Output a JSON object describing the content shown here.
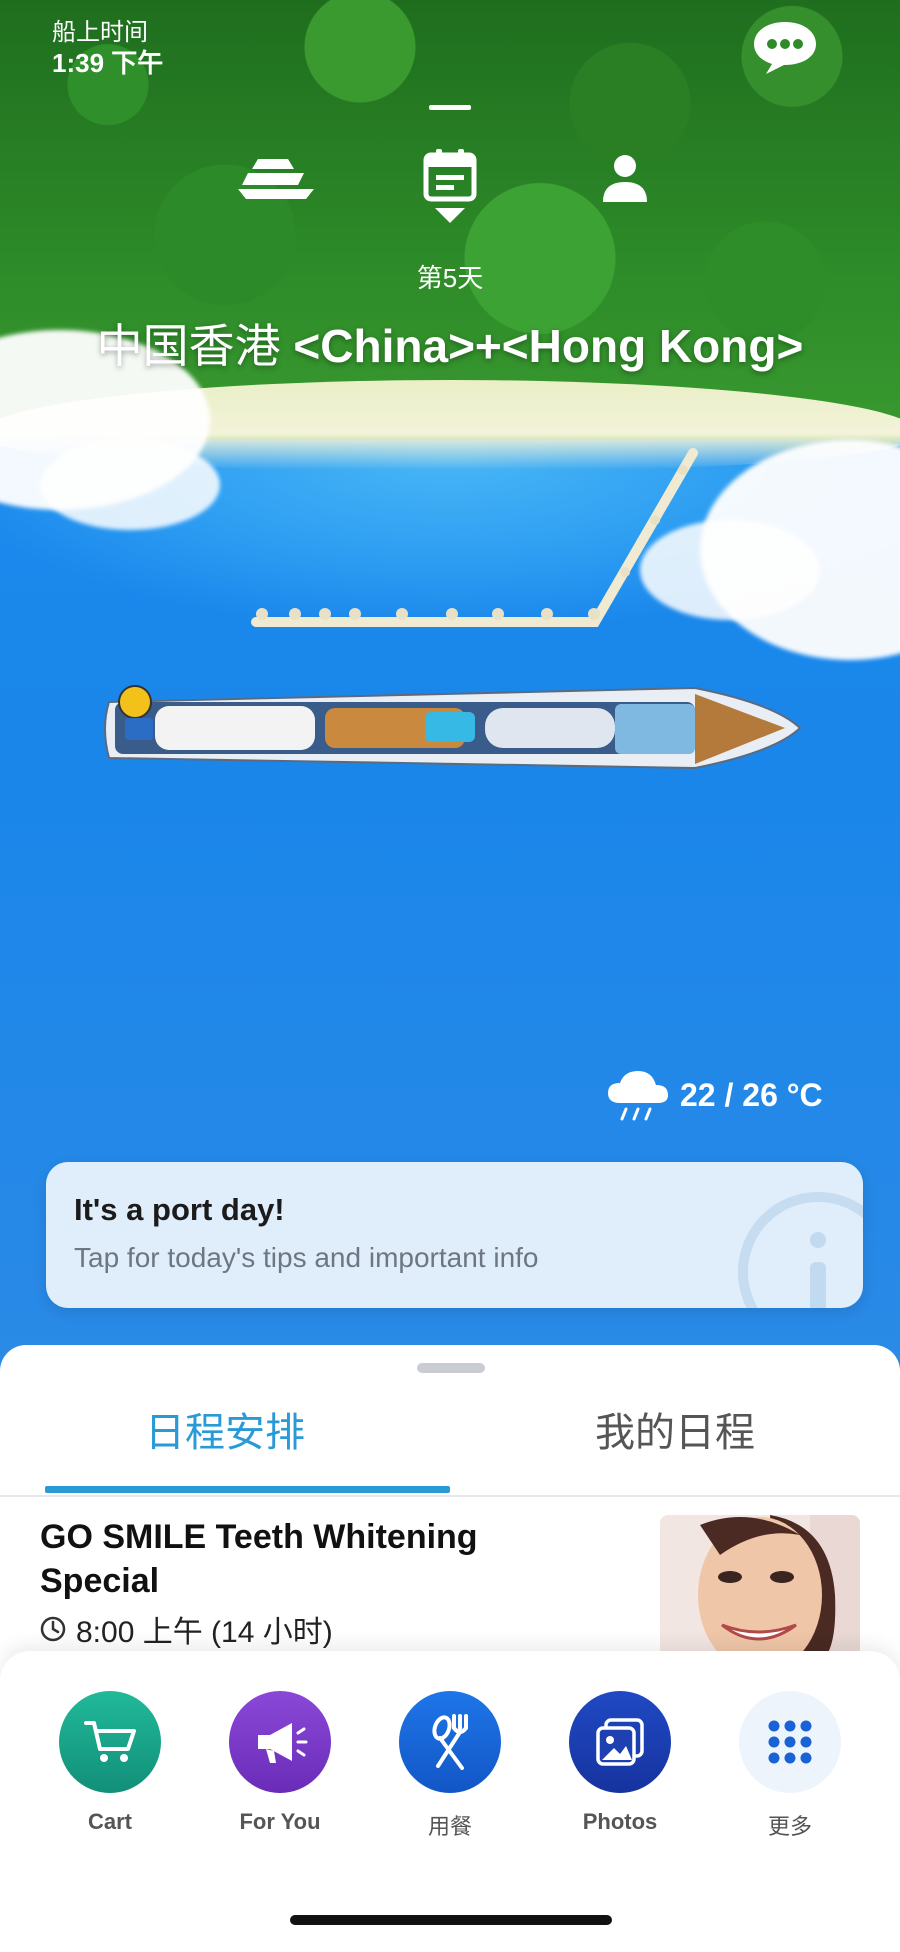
{
  "ship_time": {
    "label": "船上时间",
    "value": "1:39 下午"
  },
  "top_nav": {
    "items": [
      {
        "name": "ship",
        "icon": "cruise-ship-icon"
      },
      {
        "name": "calendar",
        "icon": "calendar-icon",
        "selected": true
      },
      {
        "name": "profile",
        "icon": "person-icon"
      }
    ]
  },
  "day_label": "第5天",
  "port": {
    "name_cn": "中国香港",
    "name_en": "<China>+<Hong Kong>"
  },
  "weather": {
    "icon": "rain-cloud-icon",
    "temperature": "22 / 26 °C"
  },
  "port_card": {
    "title": "It's a port day!",
    "subtitle": "Tap for today's tips and important info"
  },
  "tabs": [
    {
      "label": "日程安排",
      "active": true
    },
    {
      "label": "我的日程",
      "active": false
    }
  ],
  "event": {
    "title": "GO SMILE Teeth Whitening Special",
    "time": "8:00 上午 (14 小时)"
  },
  "dock": [
    {
      "label": "Cart",
      "icon": "cart-icon",
      "color": "#18a98d"
    },
    {
      "label": "For You",
      "icon": "megaphone-icon",
      "color": "#7a38c9"
    },
    {
      "label": "用餐",
      "icon": "fork-spoon-icon",
      "color": "#1665d8"
    },
    {
      "label": "Photos",
      "icon": "photos-icon",
      "color": "#1a3fb0"
    },
    {
      "label": "更多",
      "icon": "grid-icon",
      "color": "#eef4fb"
    }
  ],
  "colors": {
    "accent": "#2a9ad6",
    "sea": "#1a86ea"
  }
}
